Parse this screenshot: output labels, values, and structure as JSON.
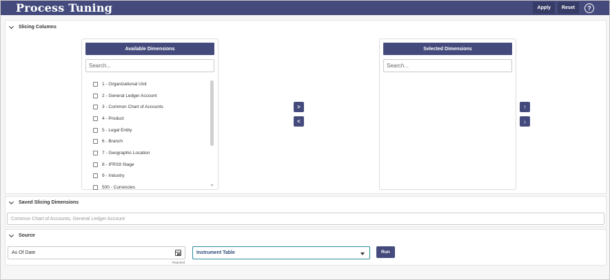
{
  "header": {
    "title": "Process Tuning",
    "apply_label": "Apply",
    "reset_label": "Reset",
    "help_glyph": "?"
  },
  "slicing": {
    "section_title": "Slicing Columns",
    "available": {
      "title": "Available Dimensions",
      "search_placeholder": "Search...",
      "items": [
        "1 - Organizational Unit",
        "2 - General Ledger Account",
        "3 - Common Chart of Accounts",
        "4 - Product",
        "5 - Legal Entity",
        "6 - Branch",
        "7 - Geographic Location",
        "8 - IFRS9 Stage",
        "9 - Industry",
        "500 - Currencies"
      ]
    },
    "selected": {
      "title": "Selected Dimensions",
      "search_placeholder": "Search..."
    },
    "move_right": ">",
    "move_left": "<",
    "move_up": "↑",
    "move_down": "↓"
  },
  "saved": {
    "section_title": "Saved Slicing Dimensions",
    "value": "Common Chart of Accounts, General Ledger Account"
  },
  "source": {
    "section_title": "Source",
    "as_of_date_label": "As Of Date",
    "required_label": "Required",
    "table_value": "Instrument Table",
    "run_label": "Run"
  },
  "colors": {
    "brand": "#444b7c",
    "accent_border": "#2a8a9a"
  }
}
